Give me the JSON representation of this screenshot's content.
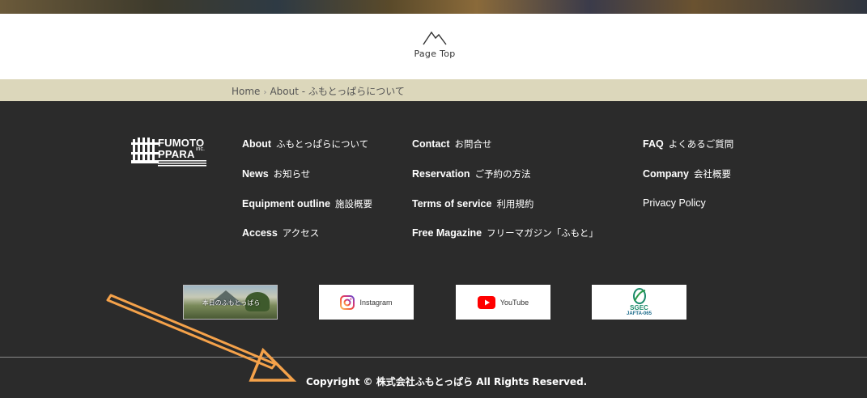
{
  "page_top": {
    "label": "Page Top"
  },
  "breadcrumb": {
    "items": [
      {
        "label": "Home"
      },
      {
        "label": "About - ふもとっぱらについて"
      }
    ],
    "separator": "›"
  },
  "footer": {
    "logo": {
      "line1": "FUMOTO",
      "line2": "PPARA",
      "suffix": "inc."
    },
    "nav": [
      {
        "en": "About",
        "ja": "ふもとっぱらについて"
      },
      {
        "en": "News",
        "ja": "お知らせ"
      },
      {
        "en": "Equipment outline",
        "ja": "施設概要"
      },
      {
        "en": "Access",
        "ja": "アクセス"
      },
      {
        "en": "Contact",
        "ja": "お問合せ"
      },
      {
        "en": "Reservation",
        "ja": "ご予約の方法"
      },
      {
        "en": "Terms of service",
        "ja": "利用規約"
      },
      {
        "en": "Free Magazine",
        "ja": "フリーマガジン「ふもと」"
      },
      {
        "en": "FAQ",
        "ja": "よくあるご質問"
      },
      {
        "en": "Company",
        "ja": "会社概要"
      },
      {
        "plain": "Privacy Policy"
      }
    ],
    "banners": {
      "today": {
        "caption": "本日のふもとっぱら"
      },
      "instagram": {
        "label": "Instagram",
        "icon": "instagram-icon"
      },
      "youtube": {
        "label": "YouTube",
        "icon": "youtube-icon"
      },
      "sgec": {
        "line1": "SGEC",
        "line2": "JAFTA-065",
        "icon": "sgec-leaf-icon"
      }
    },
    "copyright": "Copyright © 株式会社ふもとっぱら All Rights Reserved."
  },
  "colors": {
    "footer_bg": "#2b2b2b",
    "breadcrumb_bg": "#dcd7bb",
    "annotation_arrow": "#f5a24a",
    "youtube_red": "#ff0000",
    "sgec_green": "#1a8a6a"
  }
}
